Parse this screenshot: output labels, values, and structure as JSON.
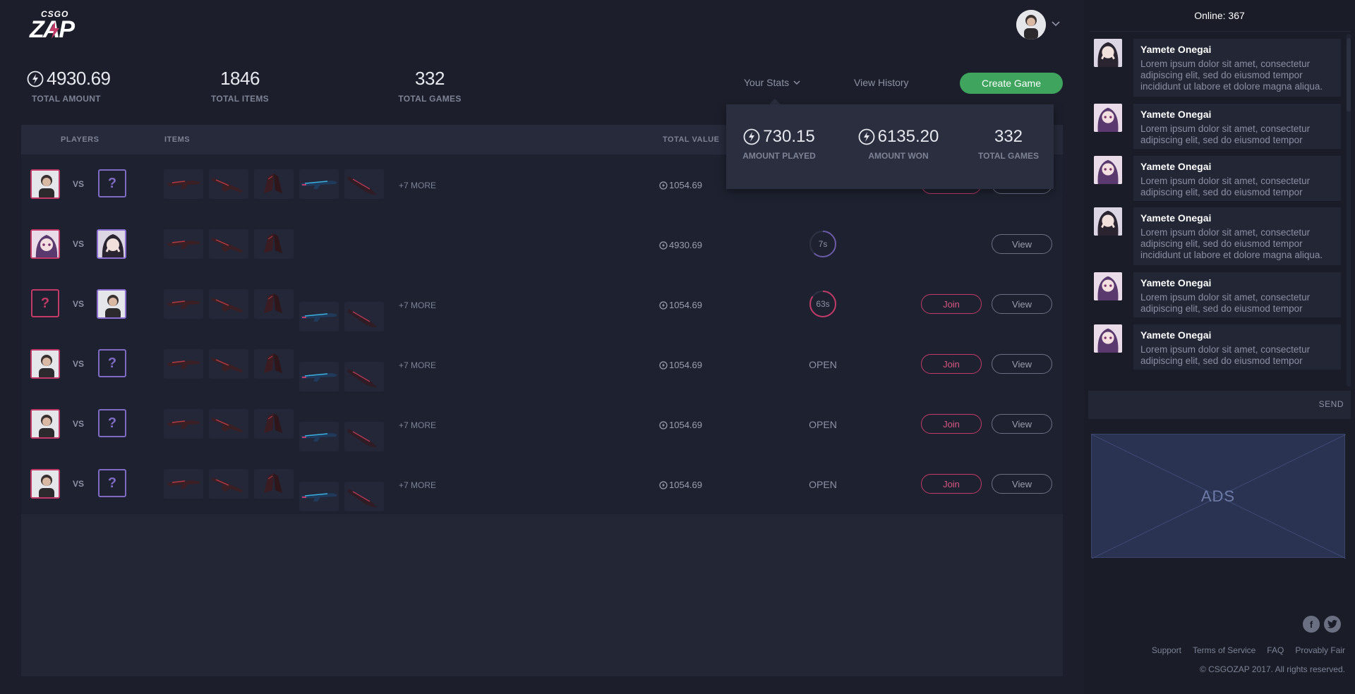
{
  "logo": {
    "top": "CSGO",
    "main": "ZAP"
  },
  "summary": [
    {
      "value": "4930.69",
      "label": "TOTAL AMOUNT",
      "icon": "bolt-icon"
    },
    {
      "value": "1846",
      "label": "TOTAL ITEMS"
    },
    {
      "value": "332",
      "label": "TOTAL GAMES"
    }
  ],
  "nav": {
    "your_stats": "Your Stats",
    "view_history": "View History",
    "create_game": "Create Game"
  },
  "dropdown": [
    {
      "value": "730.15",
      "label": "AMOUNT PLAYED",
      "icon": "bolt-icon"
    },
    {
      "value": "6135.20",
      "label": "AMOUNT WON",
      "icon": "bolt-icon"
    },
    {
      "value": "332",
      "label": "TOTAL GAMES"
    }
  ],
  "table": {
    "headers": {
      "players": "PLAYERS",
      "items": "ITEMS",
      "total_value": "TOTAL VALUE"
    },
    "vs": "VS",
    "join": "Join",
    "view": "View",
    "rows": [
      {
        "more": "+7 MORE",
        "value": "1054.69",
        "status": "",
        "timer": ""
      },
      {
        "more": "",
        "value": "4930.69",
        "status": "",
        "timer": "7s"
      },
      {
        "more": "+7 MORE",
        "value": "1054.69",
        "status": "",
        "timer": "63s"
      },
      {
        "more": "+7 MORE",
        "value": "1054.69",
        "status": "OPEN",
        "timer": ""
      },
      {
        "more": "+7 MORE",
        "value": "1054.69",
        "status": "OPEN",
        "timer": ""
      },
      {
        "more": "+7 MORE",
        "value": "1054.69",
        "status": "OPEN",
        "timer": ""
      }
    ]
  },
  "chat": {
    "online": "Online: 367",
    "messages": [
      {
        "name": "Yamete Onegai",
        "text": "Lorem ipsum dolor sit amet, consectetur adipiscing elit, sed do eiusmod tempor incididunt ut labore et dolore magna aliqua."
      },
      {
        "name": "Yamete Onegai",
        "text": "Lorem ipsum dolor sit amet, consectetur adipiscing elit, sed do eiusmod tempor"
      },
      {
        "name": "Yamete Onegai",
        "text": "Lorem ipsum dolor sit amet, consectetur adipiscing elit, sed do eiusmod tempor"
      },
      {
        "name": "Yamete Onegai",
        "text": "Lorem ipsum dolor sit amet, consectetur adipiscing elit, sed do eiusmod tempor incididunt ut labore et dolore magna aliqua."
      },
      {
        "name": "Yamete Onegai",
        "text": "Lorem ipsum dolor sit amet, consectetur adipiscing elit, sed do eiusmod tempor"
      },
      {
        "name": "Yamete Onegai",
        "text": "Lorem ipsum dolor sit amet, consectetur adipiscing elit, sed do eiusmod tempor"
      }
    ],
    "input_placeholder": "",
    "send": "SEND"
  },
  "ads": "ADS",
  "footer": {
    "links": [
      "Support",
      "Terms of Service",
      "FAQ",
      "Provably Fair"
    ],
    "copyright": "© CSGOZAP 2017. All rights reserved."
  },
  "colors": {
    "accent_green": "#3fa55e",
    "accent_pink": "#c23a67",
    "accent_purple": "#7f6bc4",
    "bg": "#1c1f2b"
  }
}
